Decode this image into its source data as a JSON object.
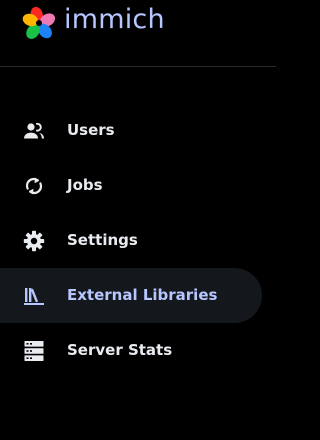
{
  "brand": {
    "name": "immich",
    "logo_icon": "immich-pinwheel-logo",
    "name_color": "#b8c6ff"
  },
  "nav": {
    "items": [
      {
        "label": "Users",
        "icon": "users-icon",
        "active": false
      },
      {
        "label": "Jobs",
        "icon": "sync-icon",
        "active": false
      },
      {
        "label": "Settings",
        "icon": "gear-icon",
        "active": false
      },
      {
        "label": "External Libraries",
        "icon": "library-shelves-icon",
        "active": true
      },
      {
        "label": "Server Stats",
        "icon": "server-icon",
        "active": false
      }
    ]
  },
  "colors": {
    "background": "#000000",
    "active_item_bg": "#14181d",
    "active_text": "#b8c6ff",
    "text": "#e8ebef"
  }
}
